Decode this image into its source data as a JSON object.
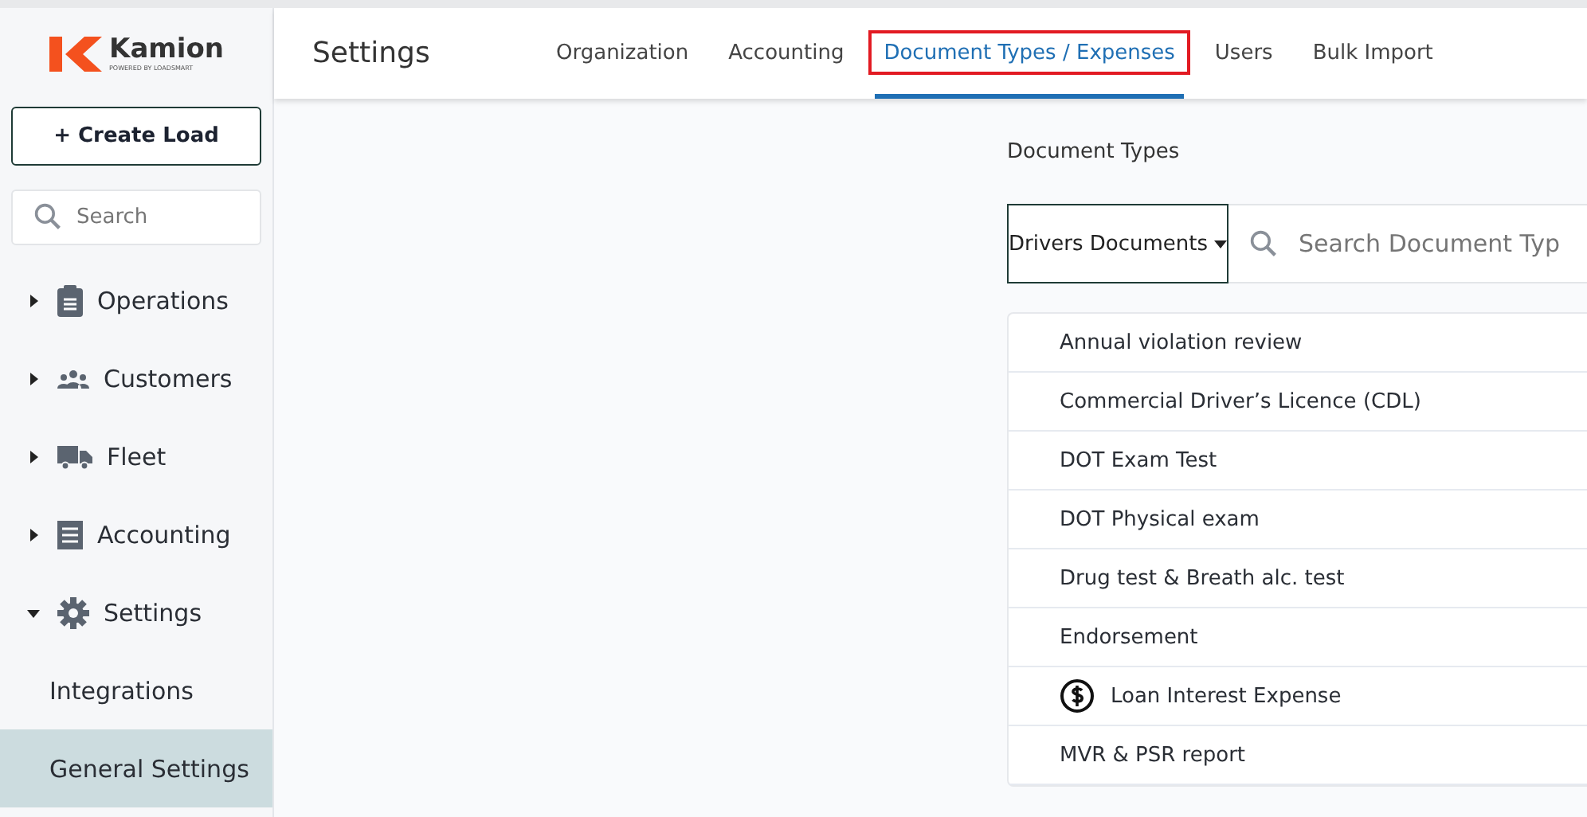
{
  "brand": {
    "name": "Kamion",
    "tagline": "POWERED BY LOADSMART"
  },
  "create_button": {
    "label": "Create Load",
    "icon": "+"
  },
  "sidebar": {
    "search": {
      "placeholder": "Search"
    },
    "items": [
      {
        "label": "Operations",
        "expanded": false,
        "selected": false
      },
      {
        "label": "Customers",
        "expanded": false,
        "selected": false
      },
      {
        "label": "Fleet",
        "expanded": false,
        "selected": false
      },
      {
        "label": "Accounting",
        "expanded": false,
        "selected": false
      },
      {
        "label": "Settings",
        "expanded": true,
        "selected": false,
        "children": [
          {
            "label": "Integrations",
            "selected": false
          },
          {
            "label": "General Settings",
            "selected": true
          }
        ]
      }
    ]
  },
  "header": {
    "title": "Settings",
    "tabs": [
      {
        "label": "Organization",
        "selected": false,
        "highlighted": false
      },
      {
        "label": "Accounting",
        "selected": false,
        "highlighted": false
      },
      {
        "label": "Document Types / Expenses",
        "selected": true,
        "highlighted": true
      },
      {
        "label": "Users",
        "selected": false,
        "highlighted": false
      },
      {
        "label": "Bulk Import",
        "selected": false,
        "highlighted": false
      }
    ]
  },
  "content": {
    "section_title": "Document Types",
    "filter": {
      "value": "Drivers Documents"
    },
    "search": {
      "placeholder": "Search Document Typ"
    },
    "rows": [
      {
        "label": "Annual violation review",
        "kind": "document"
      },
      {
        "label": "Commercial Driver’s Licence (CDL)",
        "kind": "document"
      },
      {
        "label": "DOT Exam Test",
        "kind": "document"
      },
      {
        "label": "DOT Physical exam",
        "kind": "document"
      },
      {
        "label": "Drug test & Breath alc. test",
        "kind": "document"
      },
      {
        "label": "Endorsement",
        "kind": "document"
      },
      {
        "label": "Loan Interest Expense",
        "kind": "expense"
      },
      {
        "label": "MVR & PSR report",
        "kind": "document"
      }
    ]
  }
}
